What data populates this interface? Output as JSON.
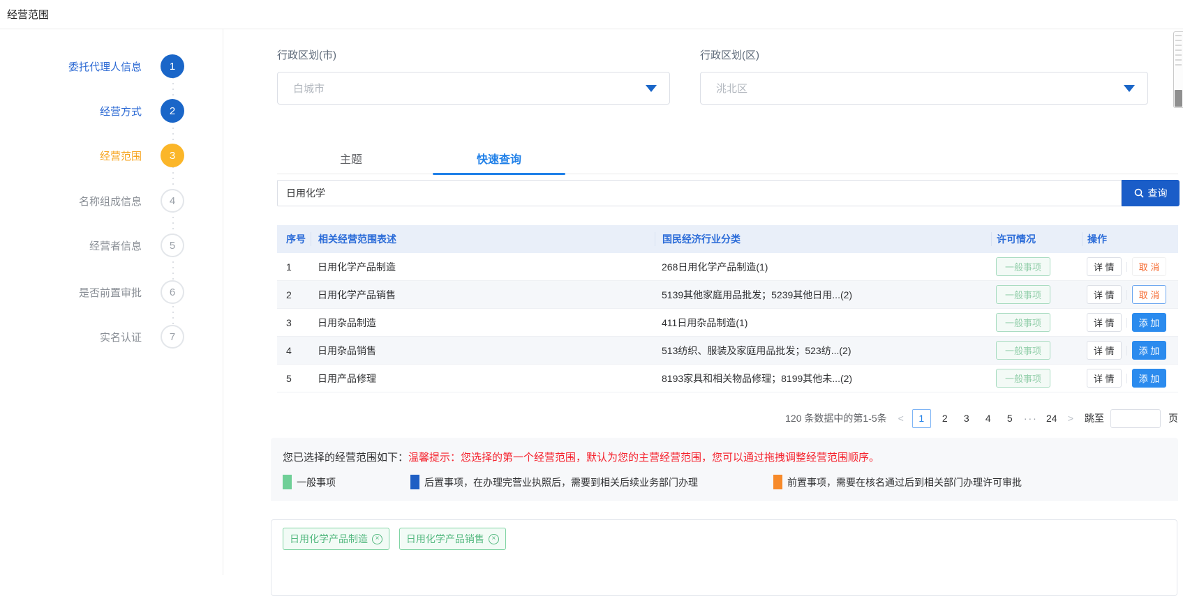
{
  "page": {
    "title": "经营范围"
  },
  "stepper": {
    "items": [
      {
        "label": "委托代理人信息",
        "num": "1",
        "state": "done"
      },
      {
        "label": "经营方式",
        "num": "2",
        "state": "done"
      },
      {
        "label": "经营范围",
        "num": "3",
        "state": "current"
      },
      {
        "label": "名称组成信息",
        "num": "4",
        "state": "todo"
      },
      {
        "label": "经营者信息",
        "num": "5",
        "state": "todo"
      },
      {
        "label": "是否前置审批",
        "num": "6",
        "state": "todo"
      },
      {
        "label": "实名认证",
        "num": "7",
        "state": "todo"
      }
    ]
  },
  "filters": {
    "city": {
      "label": "行政区划(市)",
      "value": "白城市"
    },
    "district": {
      "label": "行政区划(区)",
      "value": "洮北区"
    }
  },
  "tabs": {
    "theme": "主题",
    "quick": "快速查询"
  },
  "search": {
    "value": "日用化学",
    "button": "查询"
  },
  "table": {
    "columns": {
      "no": "序号",
      "desc": "相关经营范围表述",
      "industry": "国民经济行业分类",
      "license": "许可情况",
      "op": "操作"
    },
    "detail_label": "详 情",
    "rows": [
      {
        "no": "1",
        "desc": "日用化学产品制造",
        "industry": "268日用化学产品制造(1)",
        "license": "一般事项",
        "action": "取 消"
      },
      {
        "no": "2",
        "desc": "日用化学产品销售",
        "industry": "5139其他家庭用品批发；5239其他日用...(2)",
        "license": "一般事项",
        "action": "取 消"
      },
      {
        "no": "3",
        "desc": "日用杂品制造",
        "industry": "411日用杂品制造(1)",
        "license": "一般事项",
        "action": "添 加"
      },
      {
        "no": "4",
        "desc": "日用杂品销售",
        "industry": "513纺织、服装及家庭用品批发；523纺...(2)",
        "license": "一般事项",
        "action": "添 加"
      },
      {
        "no": "5",
        "desc": "日用产品修理",
        "industry": "8193家具和相关物品修理；8199其他未...(2)",
        "license": "一般事项",
        "action": "添 加"
      }
    ]
  },
  "pagination": {
    "summary": "120 条数据中的第1-5条",
    "prev": "<",
    "next": ">",
    "pages": [
      "1",
      "2",
      "3",
      "4",
      "5",
      "···",
      "24"
    ],
    "current": "1",
    "jump_label": "跳至",
    "page_label": "页",
    "jump_value": ""
  },
  "selected": {
    "title": "您已选择的经营范围如下：",
    "warning": "温馨提示：您选择的第一个经营范围，默认为您的主营经营范围，您可以通过拖拽调整经营范围顺序。",
    "legend": [
      {
        "color": "#6fcf97",
        "label": "一般事项"
      },
      {
        "color": "#1f5fc4",
        "label": "后置事项，在办理完营业执照后，需要到相关后续业务部门办理"
      },
      {
        "color": "#f78a2a",
        "label": "前置事项，需要在核名通过后到相关部门办理许可审批"
      }
    ],
    "tags": [
      "日用化学产品制造",
      "日用化学产品销售"
    ]
  },
  "colors": {
    "accent_blue": "#1a66c8",
    "tab_blue": "#2080e8",
    "step_amber": "#fbb629",
    "add_blue": "#2b8bee",
    "cancel_orange": "#f5682e",
    "warning_red": "#f5222d",
    "badge_green": "#93cfab"
  }
}
